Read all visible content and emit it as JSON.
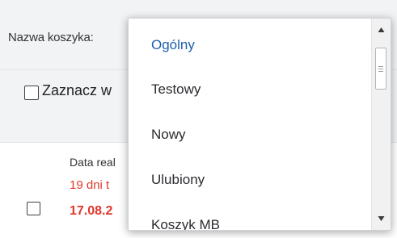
{
  "header": {
    "basket_label": "Nazwa koszyka:"
  },
  "select_all": {
    "label": "Zaznacz w"
  },
  "item": {
    "line1": "Data real",
    "line2": "19 dni t",
    "line3": "17.08.2",
    "line2_color": "#e0382b",
    "line3_color": "#e0382b"
  },
  "dropdown": {
    "options": [
      {
        "label": "Ogólny",
        "selected": true
      },
      {
        "label": "Testowy",
        "selected": false
      },
      {
        "label": "Nowy",
        "selected": false
      },
      {
        "label": "Ulubiony",
        "selected": false
      },
      {
        "label": "Koszyk MB",
        "selected": false
      }
    ],
    "selected_color": "#1f5fa8"
  },
  "scrollbar": {
    "up_icon": "triangle-up-icon",
    "down_icon": "triangle-down-icon"
  }
}
